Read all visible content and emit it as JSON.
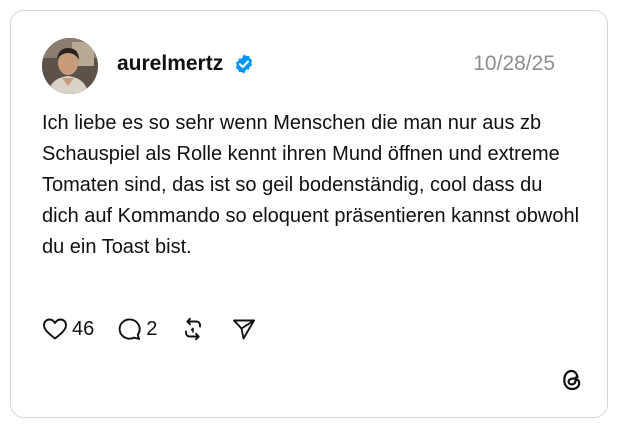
{
  "post": {
    "username": "aurelmertz",
    "verified": true,
    "date": "10/28/25",
    "text": "Ich liebe es so sehr wenn Menschen die man nur aus zb Schauspiel als Rolle kennt ihren Mund öffnen und extreme Tomaten sind, das ist so geil bodenständig, cool dass du dich auf Kommando so eloquent präsentieren kannst obwohl du ein Toast bist.",
    "likes": "46",
    "replies": "2"
  },
  "icons": {
    "verified": "verified-badge-icon",
    "like": "heart-icon",
    "reply": "comment-bubble-icon",
    "repost": "repost-icon",
    "share": "send-icon",
    "brand": "threads-logo"
  },
  "colors": {
    "verified_blue": "#0095f6",
    "muted_text": "#8e8e8e",
    "text": "#101010",
    "border": "#d6d6d6"
  }
}
